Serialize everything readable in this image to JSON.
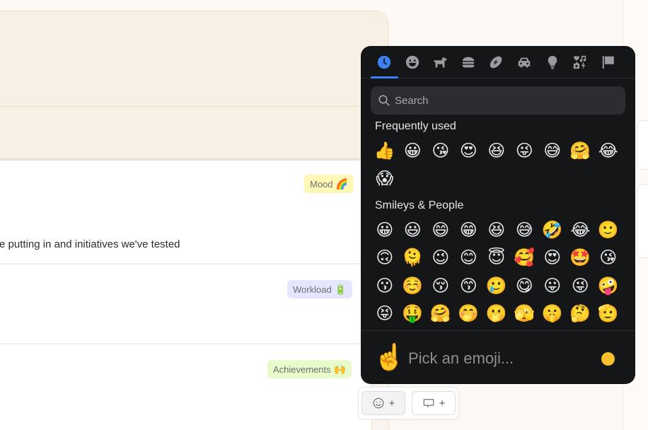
{
  "document": {
    "body_text": "re putting in and initiatives we've tested",
    "tags": [
      {
        "label": "Mood",
        "emoji": "🌈"
      },
      {
        "label": "Workload",
        "emoji": "🔋"
      },
      {
        "label": "Achievements",
        "emoji": "🙌"
      }
    ]
  },
  "emoji_picker": {
    "categories": [
      {
        "name": "recent",
        "icon": "clock-icon",
        "active": true
      },
      {
        "name": "smileys",
        "icon": "smiley-icon"
      },
      {
        "name": "animals",
        "icon": "dog-icon"
      },
      {
        "name": "food",
        "icon": "burger-icon"
      },
      {
        "name": "activities",
        "icon": "football-icon"
      },
      {
        "name": "travel",
        "icon": "car-icon"
      },
      {
        "name": "objects",
        "icon": "lightbulb-icon"
      },
      {
        "name": "symbols",
        "icon": "symbols-icon"
      },
      {
        "name": "flags",
        "icon": "flag-icon"
      }
    ],
    "accent_color": "#3d7ff5",
    "search_placeholder": "Search",
    "sections": [
      {
        "title": "Frequently used",
        "emojis": [
          "👍",
          "😀",
          "😘",
          "😍",
          "😆",
          "😜",
          "😅",
          "🤗",
          "😂",
          "😱"
        ]
      },
      {
        "title": "Smileys & People",
        "emojis": [
          "😀",
          "😃",
          "😄",
          "😁",
          "😆",
          "😅",
          "🤣",
          "😂",
          "🙂",
          "🙃",
          "🫠",
          "😉",
          "😊",
          "😇",
          "🥰",
          "😍",
          "🤩",
          "😘",
          "😗",
          "☺️",
          "😚",
          "😙",
          "🥲",
          "😋",
          "😛",
          "😜",
          "🤪",
          "😝",
          "🤑",
          "🤗",
          "🤭",
          "🫢",
          "🫣",
          "🤫",
          "🤔",
          "🫡"
        ]
      }
    ],
    "preview_emoji": "☝️",
    "preview_placeholder": "Pick an emoji...",
    "skin_tone_color": "#fbc02d"
  },
  "action_bar": {
    "add_reaction_label": "+",
    "add_comment_label": "+"
  }
}
